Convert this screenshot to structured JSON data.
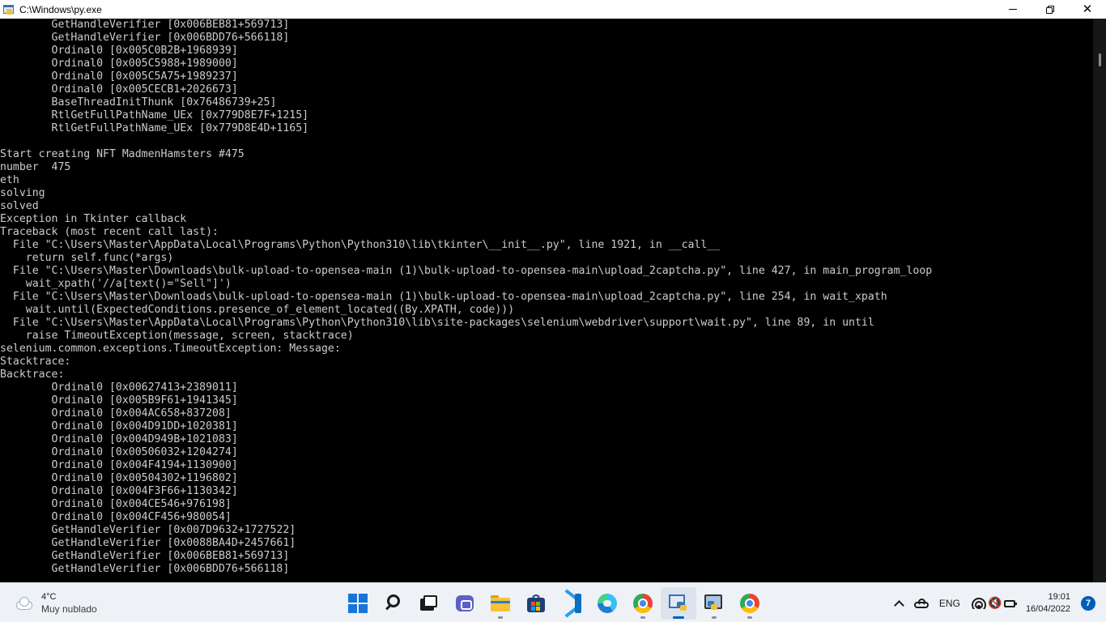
{
  "window": {
    "title": "C:\\Windows\\py.exe",
    "minimize_icon": "minimize-icon",
    "restore_icon": "restore-icon",
    "close_icon": "close-icon",
    "close_glyph": "✕"
  },
  "console": {
    "lines": [
      "        GetHandleVerifier [0x006BEB81+569713]",
      "        GetHandleVerifier [0x006BDD76+566118]",
      "        Ordinal0 [0x005C0B2B+1968939]",
      "        Ordinal0 [0x005C5988+1989000]",
      "        Ordinal0 [0x005C5A75+1989237]",
      "        Ordinal0 [0x005CECB1+2026673]",
      "        BaseThreadInitThunk [0x76486739+25]",
      "        RtlGetFullPathName_UEx [0x779D8E7F+1215]",
      "        RtlGetFullPathName_UEx [0x779D8E4D+1165]",
      "",
      "Start creating NFT MadmenHamsters #475",
      "number  475",
      "eth",
      "solving",
      "solved",
      "Exception in Tkinter callback",
      "Traceback (most recent call last):",
      "  File \"C:\\Users\\Master\\AppData\\Local\\Programs\\Python\\Python310\\lib\\tkinter\\__init__.py\", line 1921, in __call__",
      "    return self.func(*args)",
      "  File \"C:\\Users\\Master\\Downloads\\bulk-upload-to-opensea-main (1)\\bulk-upload-to-opensea-main\\upload_2captcha.py\", line 427, in main_program_loop",
      "    wait_xpath('//a[text()=\"Sell\"]')",
      "  File \"C:\\Users\\Master\\Downloads\\bulk-upload-to-opensea-main (1)\\bulk-upload-to-opensea-main\\upload_2captcha.py\", line 254, in wait_xpath",
      "    wait.until(ExpectedConditions.presence_of_element_located((By.XPATH, code)))",
      "  File \"C:\\Users\\Master\\AppData\\Local\\Programs\\Python\\Python310\\lib\\site-packages\\selenium\\webdriver\\support\\wait.py\", line 89, in until",
      "    raise TimeoutException(message, screen, stacktrace)",
      "selenium.common.exceptions.TimeoutException: Message:",
      "Stacktrace:",
      "Backtrace:",
      "        Ordinal0 [0x00627413+2389011]",
      "        Ordinal0 [0x005B9F61+1941345]",
      "        Ordinal0 [0x004AC658+837208]",
      "        Ordinal0 [0x004D91DD+1020381]",
      "        Ordinal0 [0x004D949B+1021083]",
      "        Ordinal0 [0x00506032+1204274]",
      "        Ordinal0 [0x004F4194+1130900]",
      "        Ordinal0 [0x00504302+1196802]",
      "        Ordinal0 [0x004F3F66+1130342]",
      "        Ordinal0 [0x004CE546+976198]",
      "        Ordinal0 [0x004CF456+980054]",
      "        GetHandleVerifier [0x007D9632+1727522]",
      "        GetHandleVerifier [0x0088BA4D+2457661]",
      "        GetHandleVerifier [0x006BEB81+569713]",
      "        GetHandleVerifier [0x006BDD76+566118]"
    ]
  },
  "taskbar": {
    "weather": {
      "temp": "4°C",
      "desc": "Muy nublado",
      "icon": "cloud-icon"
    },
    "apps": [
      {
        "name": "start",
        "icon": "windows-start-icon"
      },
      {
        "name": "search",
        "icon": "search-icon"
      },
      {
        "name": "task-view",
        "icon": "task-view-icon"
      },
      {
        "name": "chat",
        "icon": "chat-icon"
      },
      {
        "name": "file-explorer",
        "icon": "folder-icon"
      },
      {
        "name": "store",
        "icon": "store-icon"
      },
      {
        "name": "vscode",
        "icon": "vscode-icon"
      },
      {
        "name": "edge",
        "icon": "edge-icon"
      },
      {
        "name": "chrome",
        "icon": "chrome-icon"
      },
      {
        "name": "python-console",
        "icon": "python-window-icon",
        "active": true
      },
      {
        "name": "python-idle",
        "icon": "python-idle-icon"
      },
      {
        "name": "chrome-2",
        "icon": "chrome-icon"
      }
    ],
    "tray": {
      "language": "ENG",
      "time": "19:01",
      "date": "16/04/2022",
      "notifications": "7",
      "speaker_glyph": "🔇",
      "colors": {
        "accent": "#005fb8"
      }
    }
  }
}
